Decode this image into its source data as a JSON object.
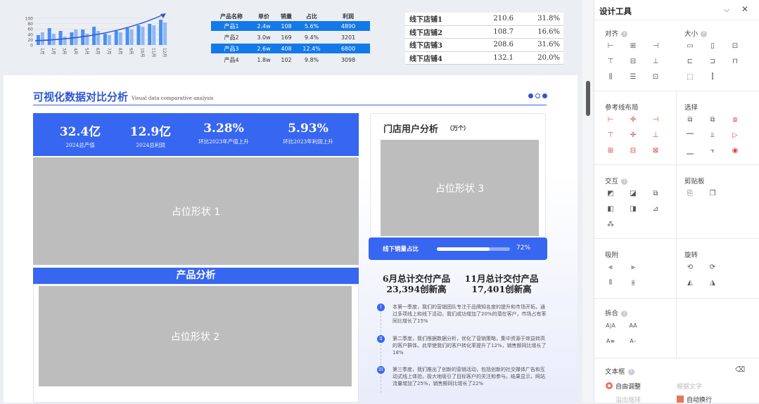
{
  "mini_chart": {
    "months": [
      "1月",
      "2月",
      "3月",
      "4月",
      "5月",
      "6月",
      "7月",
      "8月",
      "9月",
      "10月",
      "11月",
      "12月"
    ],
    "yticks": [
      "100",
      "80",
      "60",
      "40",
      "20",
      "0"
    ]
  },
  "product_table": {
    "headers": [
      "产品名称",
      "单价",
      "销量",
      "占比",
      "利润"
    ],
    "rows": [
      [
        "产品1",
        "2.4w",
        "108",
        "5.6%",
        "4890"
      ],
      [
        "产品2",
        "3.0w",
        "169",
        "9.4%",
        "3201"
      ],
      [
        "产品3",
        "2.6w",
        "408",
        "12.4%",
        "6800"
      ],
      [
        "产品4",
        "1.8w",
        "102",
        "9.8%",
        "3098"
      ]
    ]
  },
  "store_table": {
    "rows": [
      [
        "线下店铺1",
        "210.6",
        "31.8%"
      ],
      [
        "线下店铺2",
        "108.7",
        "16.6%"
      ],
      [
        "线下店铺3",
        "208.6",
        "31.6%"
      ],
      [
        "线下店铺4",
        "132.1",
        "20.0%"
      ]
    ]
  },
  "slide": {
    "title": "可视化数据对比分析",
    "subtitle": "Visual data comparative analysis",
    "kpis": [
      {
        "value": "32.4亿",
        "label": "2024总产值"
      },
      {
        "value": "12.9亿",
        "label": "2024总利润"
      },
      {
        "value": "3.28%",
        "label": "环比2023年产值上升"
      },
      {
        "value": "5.93%",
        "label": "环比2023年利润上升"
      }
    ],
    "placeholder1": "占位形状 1",
    "placeholder2": "占位形状 2",
    "placeholder3": "占位形状 3",
    "product_section": "产品分析",
    "store_title": "门店用户分析",
    "store_unit": "（万个）",
    "progress_label": "线下销量占比",
    "progress_value": "72%",
    "progress_fraction": 0.72,
    "june": "6月总计交付产品\n23,394创新高",
    "nov": "11月总计交付产品\n17,401创新高",
    "notes": [
      {
        "num": "I",
        "text": "本第一季度，我们的营销团队专注于品牌知名度的提升和市场开拓，通过多项线上和线下活动，我们成功增加了20%的潜在客户，市场占有率同比增长了15%"
      },
      {
        "num": "II",
        "text": "第二季度，我们根据数据分析，优化了营销策略，集中资源于效益转高的客户群体。此举使我们的客户转化率提升了12%，销售额同比增长了18%"
      },
      {
        "num": "III",
        "text": "第三季度，我们推出了创新的营销活动，包括创新的社交媒体广告和互动式线上体验，极大地吸引了目标客户的关注和参与。结果显示，网站流量增加了25%，销售额同比增长了22%"
      }
    ]
  },
  "panel": {
    "title": "设计工具",
    "sections": {
      "align": "对齐",
      "size": "大小",
      "guide": "参考线布局",
      "select": "选择",
      "bool": "交互",
      "clipboard": "剪贴板",
      "adsorb": "吸附",
      "rotate": "旋转",
      "group": "拆合",
      "textbox": "文本框"
    },
    "text_opts": [
      "自由调整",
      "根据文字",
      "溢出缩排",
      "自动换行"
    ]
  },
  "colors": {
    "accent": "#3766f0",
    "highlight_row": "#1479e8",
    "panel_red": "#e0433c"
  }
}
